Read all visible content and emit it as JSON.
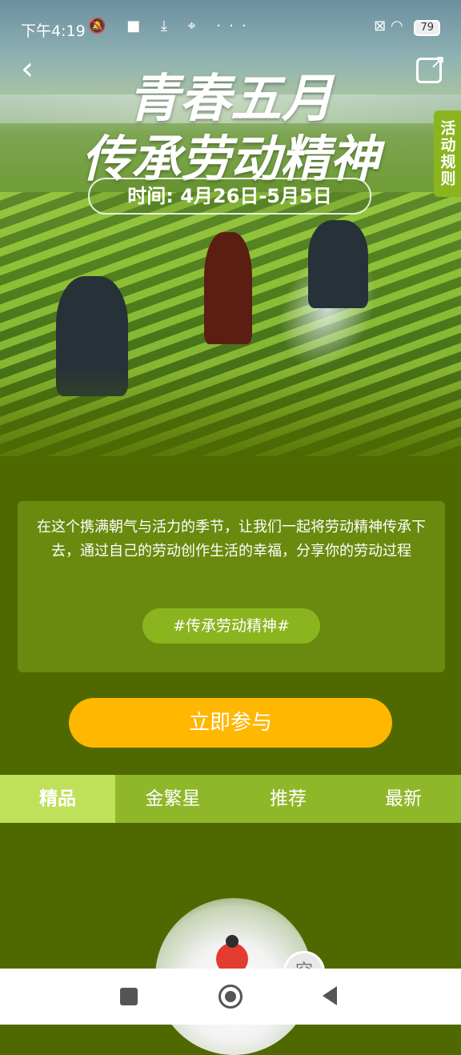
{
  "status_bar": {
    "time": "下午4:19",
    "left_icons": "🔕 ■ ⤓ ⌖ ···",
    "battery": "79"
  },
  "header": {
    "back_icon": "chevron-left-icon",
    "share_icon": "share-external-icon",
    "rules_label": "活动规则"
  },
  "hero": {
    "title_line1": "青春五月",
    "title_line2": "传承劳动精神",
    "date": "时间: 4月26日-5月5日"
  },
  "card": {
    "description": "在这个携满朝气与活力的季节，让我们一起将劳动精神传承下去，通过自己的劳动创作生活的幸福，分享你的劳动过程",
    "hashtag": "#传承劳动精神#"
  },
  "cta": {
    "join_label": "立即参与"
  },
  "tabs": [
    {
      "label": "精品",
      "active": true
    },
    {
      "label": "金繁星",
      "active": false
    },
    {
      "label": "推荐",
      "active": false
    },
    {
      "label": "最新",
      "active": false
    }
  ],
  "preview": {
    "badge_text": "空"
  },
  "colors": {
    "background": "#4f6900",
    "tab_bar": "#8fb72a",
    "tab_active": "#bfe05a",
    "button": "#ffb700",
    "rules": "#8ab51f"
  }
}
